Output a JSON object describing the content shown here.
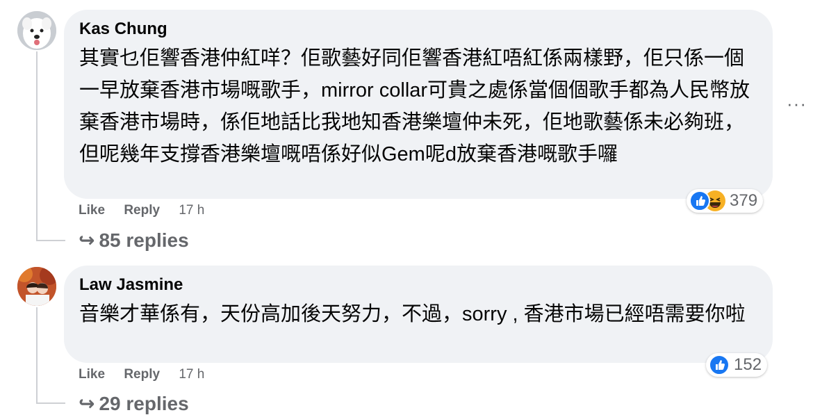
{
  "comments": [
    {
      "author": "Kas Chung",
      "text": "其實乜佢響香港仲紅咩？佢歌藝好同佢響香港紅唔紅係兩樣野，佢只係一個一早放棄香港市場嘅歌手，mirror collar可貴之處係當個個歌手都為人民幣放棄香港市場時，係佢地話比我地知香港樂壇仲未死，佢地歌藝係未必夠班，但呢幾年支撐香港樂壇嘅唔係好似Gem呢d放棄香港嘅歌手囉",
      "like_label": "Like",
      "reply_label": "Reply",
      "time": "17 h",
      "reaction_count": "379",
      "reactions": [
        "like-icon",
        "haha-icon"
      ],
      "replies_label": "85 replies"
    },
    {
      "author": "Law Jasmine",
      "text": "音樂才華係有，天份高加後天努力，不過，sorry , 香港市場已經唔需要你啦",
      "like_label": "Like",
      "reply_label": "Reply",
      "time": "17 h",
      "reaction_count": "152",
      "reactions": [
        "like-icon"
      ],
      "replies_label": "29 replies"
    }
  ],
  "more_options": "···",
  "reply_arrow": "↪",
  "colors": {
    "bubble": "#f0f2f5",
    "muted_text": "#65676b",
    "like_blue": "#1877f2",
    "haha_yellow": "#f7b125"
  }
}
